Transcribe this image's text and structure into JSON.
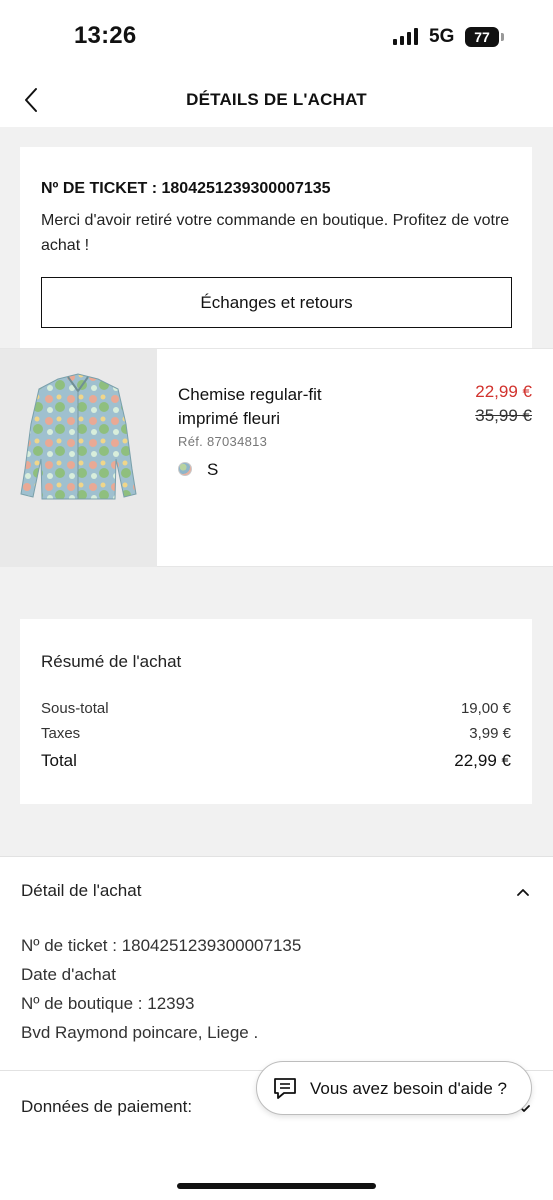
{
  "status": {
    "time": "13:26",
    "network": "5G",
    "battery": "77"
  },
  "nav": {
    "title": "DÉTAILS DE L'ACHAT"
  },
  "ticket": {
    "number_line": "Nº DE TICKET : 1804251239300007135",
    "message": "Merci d'avoir retiré votre commande en boutique. Profitez de votre achat !",
    "exchange_button": "Échanges et retours"
  },
  "product": {
    "name": "Chemise regular-fit imprimé fleuri",
    "ref": "Réf. 87034813",
    "size": "S",
    "price_now": "22,99 €",
    "price_old": "35,99 €",
    "price_now_color": "#d1322d"
  },
  "summary": {
    "title": "Résumé de l'achat",
    "subtotal_label": "Sous-total",
    "subtotal_value": "19,00 €",
    "tax_label": "Taxes",
    "tax_value": "3,99 €",
    "total_label": "Total",
    "total_value": "22,99 €"
  },
  "detail": {
    "title": "Détail de l'achat",
    "ticket_line": "Nº de ticket : 1804251239300007135",
    "date_line": "Date d'achat",
    "store_line": "Nº de boutique : 12393",
    "address_line": "Bvd Raymond poincare, Liege ."
  },
  "payment": {
    "title": "Données de paiement:"
  },
  "help": {
    "label": "Vous avez besoin d'aide ?"
  },
  "icons": {
    "back": "chevron-left-icon",
    "expand": "chevron-up-icon",
    "collapse": "chevron-down-icon",
    "chat": "chat-icon"
  }
}
